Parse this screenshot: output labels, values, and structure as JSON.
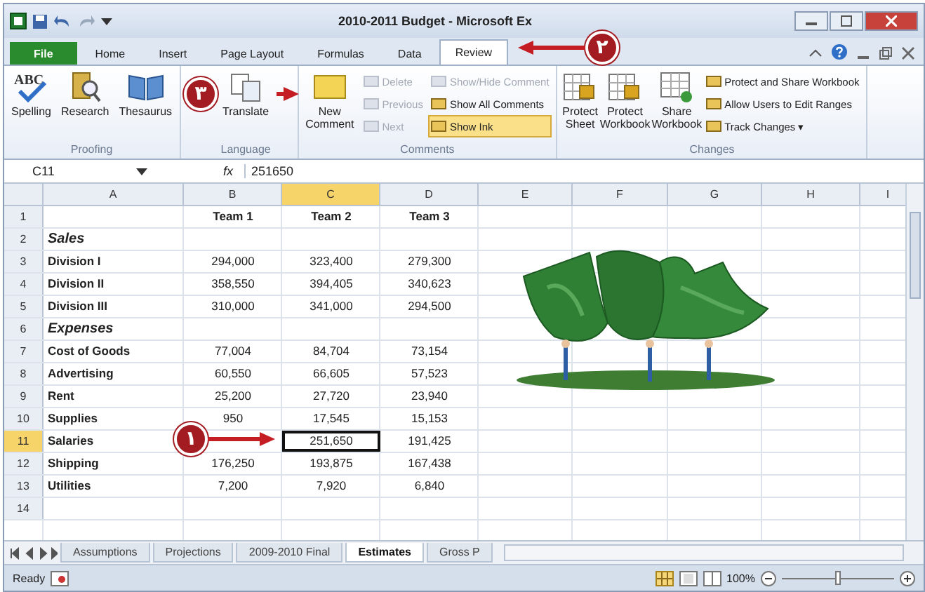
{
  "window": {
    "title": "2010-2011 Budget - Microsoft Ex"
  },
  "ribbon_tabs": [
    {
      "label": "File",
      "selected": false,
      "kind": "file"
    },
    {
      "label": "Home",
      "selected": false,
      "kind": "tab"
    },
    {
      "label": "Insert",
      "selected": false,
      "kind": "tab"
    },
    {
      "label": "Page Layout",
      "selected": false,
      "kind": "tab"
    },
    {
      "label": "Formulas",
      "selected": false,
      "kind": "tab"
    },
    {
      "label": "Data",
      "selected": false,
      "kind": "tab"
    },
    {
      "label": "Review",
      "selected": true,
      "kind": "tab"
    }
  ],
  "ribbon_groups": [
    {
      "name": "Proofing",
      "large": [
        {
          "label": "Spelling",
          "kind": "spelling",
          "icon_text": "ABC"
        },
        {
          "label": "Research",
          "kind": "research"
        },
        {
          "label": "Thesaurus",
          "kind": "thesaurus"
        }
      ]
    },
    {
      "name": "Language",
      "large": [
        {
          "label": "Translate",
          "kind": "translate"
        }
      ]
    },
    {
      "name": "Comments",
      "large": [
        {
          "label": "New\nComment",
          "kind": "comment"
        }
      ],
      "small": [
        {
          "label": "Delete",
          "disabled": true,
          "selected": false
        },
        {
          "label": "Previous",
          "disabled": true,
          "selected": false
        },
        {
          "label": "Next",
          "disabled": true,
          "selected": false
        },
        {
          "label": "Show/Hide Comment",
          "disabled": true,
          "selected": false
        },
        {
          "label": "Show All Comments",
          "disabled": false,
          "selected": false
        },
        {
          "label": "Show Ink",
          "disabled": false,
          "selected": true
        }
      ]
    },
    {
      "name": "Changes",
      "large": [
        {
          "label": "Protect\nSheet",
          "kind": "protect"
        },
        {
          "label": "Protect\nWorkbook",
          "kind": "protect"
        },
        {
          "label": "Share\nWorkbook",
          "kind": "share"
        }
      ],
      "small": [
        {
          "label": "Protect and Share Workbook",
          "disabled": false,
          "selected": false
        },
        {
          "label": "Allow Users to Edit Ranges",
          "disabled": false,
          "selected": false
        },
        {
          "label": "Track Changes ▾",
          "disabled": false,
          "selected": false
        }
      ]
    }
  ],
  "formula_bar": {
    "name_box": "C11",
    "fx": "fx",
    "value": "251650"
  },
  "sheet": {
    "columns": [
      {
        "label": "A",
        "selected": false
      },
      {
        "label": "B",
        "selected": false
      },
      {
        "label": "C",
        "selected": true
      },
      {
        "label": "D",
        "selected": false
      },
      {
        "label": "E",
        "selected": false
      },
      {
        "label": "F",
        "selected": false
      },
      {
        "label": "G",
        "selected": false
      },
      {
        "label": "H",
        "selected": false
      },
      {
        "label": "I",
        "selected": false
      }
    ],
    "rows": [
      {
        "number": "1",
        "kind": "header",
        "selected": false,
        "cells": [
          "",
          "Team 1",
          "Team 2",
          "Team 3"
        ]
      },
      {
        "number": "2",
        "kind": "section",
        "selected": false,
        "cells": [
          "Sales"
        ]
      },
      {
        "number": "3",
        "kind": "data",
        "selected": false,
        "cells": [
          "Division I",
          "294,000",
          "323,400",
          "279,300"
        ]
      },
      {
        "number": "4",
        "kind": "data",
        "selected": false,
        "cells": [
          "Division II",
          "358,550",
          "394,405",
          "340,623"
        ]
      },
      {
        "number": "5",
        "kind": "data",
        "selected": false,
        "cells": [
          "Division III",
          "310,000",
          "341,000",
          "294,500"
        ]
      },
      {
        "number": "6",
        "kind": "section",
        "selected": false,
        "cells": [
          "Expenses"
        ]
      },
      {
        "number": "7",
        "kind": "data",
        "selected": false,
        "cells": [
          "Cost of Goods",
          "77,004",
          "84,704",
          "73,154"
        ]
      },
      {
        "number": "8",
        "kind": "data",
        "selected": false,
        "cells": [
          "Advertising",
          "60,550",
          "66,605",
          "57,523"
        ]
      },
      {
        "number": "9",
        "kind": "data",
        "selected": false,
        "cells": [
          "Rent",
          "25,200",
          "27,720",
          "23,940"
        ]
      },
      {
        "number": "10",
        "kind": "data",
        "selected": false,
        "cells": [
          "Supplies",
          "950",
          "17,545",
          "15,153"
        ]
      },
      {
        "number": "11",
        "kind": "data",
        "selected": true,
        "cells": [
          "Salaries",
          "",
          "251,650",
          "191,425"
        ]
      },
      {
        "number": "12",
        "kind": "data",
        "selected": false,
        "cells": [
          "Shipping",
          "176,250",
          "193,875",
          "167,438"
        ]
      },
      {
        "number": "13",
        "kind": "data",
        "selected": false,
        "cells": [
          "Utilities",
          "7,200",
          "7,920",
          "6,840"
        ]
      },
      {
        "number": "14",
        "selected": false,
        "cells": []
      }
    ]
  },
  "sheet_tabs": [
    {
      "label": "Assumptions",
      "selected": false
    },
    {
      "label": "Projections",
      "selected": false
    },
    {
      "label": "2009-2010 Final",
      "selected": false
    },
    {
      "label": "Estimates",
      "selected": true
    },
    {
      "label": "Gross P",
      "selected": false
    }
  ],
  "status_bar": {
    "status": "Ready",
    "zoom": "100%",
    "zoom_slider": {
      "level": 0.5
    }
  },
  "callouts": [
    {
      "number": "١",
      "kind": "cell"
    },
    {
      "number": "٢",
      "kind": "tab"
    },
    {
      "number": "٣",
      "kind": "button"
    }
  ]
}
